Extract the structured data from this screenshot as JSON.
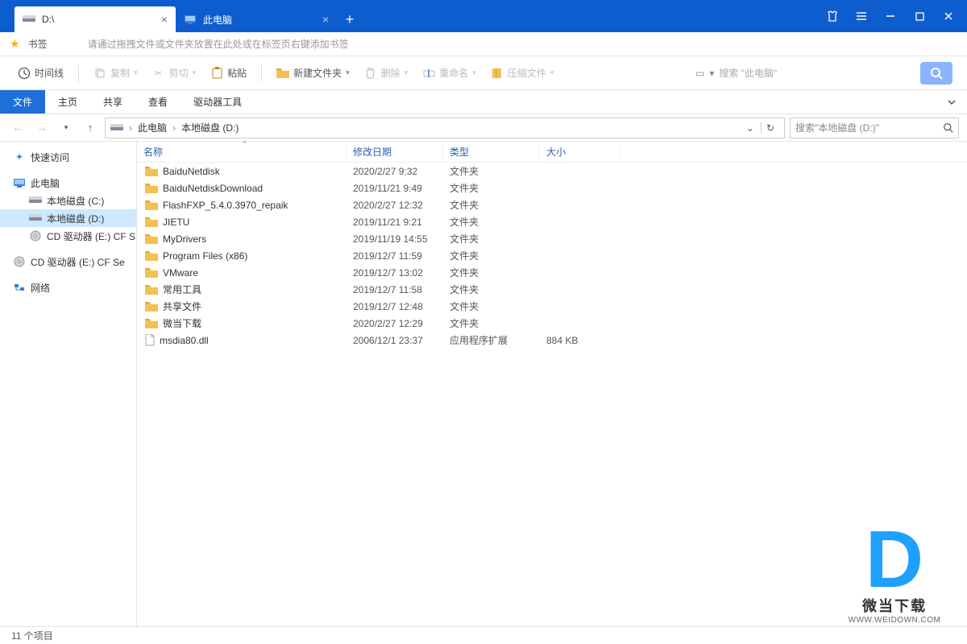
{
  "tabs": [
    {
      "label": "D:\\",
      "active": true
    },
    {
      "label": "此电脑",
      "active": false
    }
  ],
  "bookmarks": {
    "label": "书签",
    "hint": "请通过拖拽文件或文件夹放置在此处或在标签页右键添加书签"
  },
  "toolbar": {
    "timeline": "时间线",
    "copy": "复制",
    "cut": "剪切",
    "paste": "粘贴",
    "newfolder": "新建文件夹",
    "delete": "删除",
    "rename": "重命名",
    "compress": "压缩文件",
    "search_placeholder": "搜索  \"此电脑\""
  },
  "ribbon": {
    "items": [
      "文件",
      "主页",
      "共享",
      "查看",
      "驱动器工具"
    ],
    "active_index": 0
  },
  "nav": {
    "crumbs": [
      "此电脑",
      "本地磁盘 (D:)"
    ],
    "search_placeholder": "搜索\"本地磁盘 (D:)\""
  },
  "side": [
    {
      "label": "快速访问",
      "icon": "star",
      "sub": false
    },
    {
      "spacer": true
    },
    {
      "label": "此电脑",
      "icon": "pc",
      "sub": false
    },
    {
      "label": "本地磁盘 (C:)",
      "icon": "disk",
      "sub": true
    },
    {
      "label": "本地磁盘 (D:)",
      "icon": "disk",
      "sub": true,
      "selected": true
    },
    {
      "label": "CD 驱动器 (E:) CF S",
      "icon": "cd",
      "sub": true
    },
    {
      "spacer": true
    },
    {
      "label": "CD 驱动器 (E:) CF Se",
      "icon": "cd",
      "sub": false
    },
    {
      "spacer": true
    },
    {
      "label": "网络",
      "icon": "net",
      "sub": false
    }
  ],
  "columns": {
    "name": "名称",
    "date": "修改日期",
    "type": "类型",
    "size": "大小"
  },
  "rows": [
    {
      "icon": "folder",
      "name": "BaiduNetdisk",
      "date": "2020/2/27 9:32",
      "type": "文件夹",
      "size": ""
    },
    {
      "icon": "folder",
      "name": "BaiduNetdiskDownload",
      "date": "2019/11/21 9:49",
      "type": "文件夹",
      "size": ""
    },
    {
      "icon": "folder",
      "name": "FlashFXP_5.4.0.3970_repaik",
      "date": "2020/2/27 12:32",
      "type": "文件夹",
      "size": ""
    },
    {
      "icon": "folder",
      "name": "JIETU",
      "date": "2019/11/21 9:21",
      "type": "文件夹",
      "size": ""
    },
    {
      "icon": "folder",
      "name": "MyDrivers",
      "date": "2019/11/19 14:55",
      "type": "文件夹",
      "size": ""
    },
    {
      "icon": "folder",
      "name": "Program Files (x86)",
      "date": "2019/12/7 11:59",
      "type": "文件夹",
      "size": ""
    },
    {
      "icon": "folder",
      "name": "VMware",
      "date": "2019/12/7 13:02",
      "type": "文件夹",
      "size": ""
    },
    {
      "icon": "folder",
      "name": "常用工具",
      "date": "2019/12/7 11:58",
      "type": "文件夹",
      "size": ""
    },
    {
      "icon": "folder",
      "name": "共享文件",
      "date": "2019/12/7 12:48",
      "type": "文件夹",
      "size": ""
    },
    {
      "icon": "folder",
      "name": "微当下载",
      "date": "2020/2/27 12:29",
      "type": "文件夹",
      "size": ""
    },
    {
      "icon": "file",
      "name": "msdia80.dll",
      "date": "2006/12/1 23:37",
      "type": "应用程序扩展",
      "size": "884 KB"
    }
  ],
  "status": "11 个项目",
  "watermark": {
    "cn": "微当下载",
    "url": "WWW.WEIDOWN.COM"
  }
}
